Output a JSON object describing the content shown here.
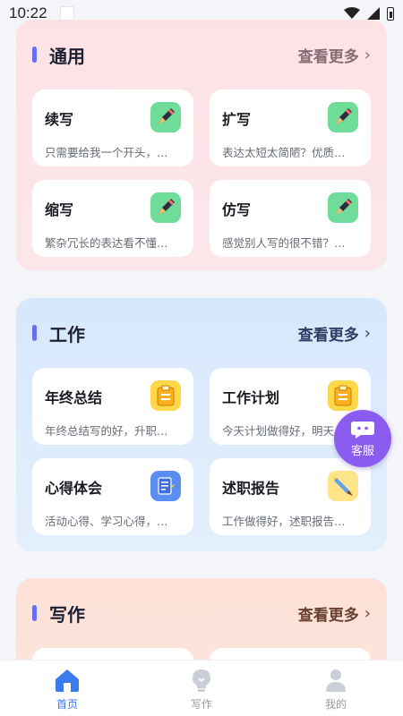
{
  "status_bar": {
    "time": "10:22"
  },
  "sections": [
    {
      "title": "通用",
      "more_label": "查看更多",
      "cards": [
        {
          "title": "续写",
          "desc": "只需要给我一个开头，…",
          "icon": "pen-icon"
        },
        {
          "title": "扩写",
          "desc": "表达太短太简陋？优质…",
          "icon": "pen-icon"
        },
        {
          "title": "缩写",
          "desc": "繁杂冗长的表达看不懂…",
          "icon": "pen-icon"
        },
        {
          "title": "仿写",
          "desc": "感觉别人写的很不错？…",
          "icon": "pen-icon"
        }
      ]
    },
    {
      "title": "工作",
      "more_label": "查看更多",
      "cards": [
        {
          "title": "年终总结",
          "desc": "年终总结写的好，升职…",
          "icon": "clipboard-icon"
        },
        {
          "title": "工作计划",
          "desc": "今天计划做得好，明天…",
          "icon": "clipboard-icon"
        },
        {
          "title": "心得体会",
          "desc": "活动心得、学习心得，…",
          "icon": "notes-icon"
        },
        {
          "title": "述职报告",
          "desc": "工作做得好，述职报告…",
          "icon": "brush-icon"
        }
      ]
    },
    {
      "title": "写作",
      "more_label": "查看更多"
    }
  ],
  "service_button": {
    "label": "客服"
  },
  "bottom_nav": {
    "items": [
      {
        "label": "首页",
        "icon": "home-icon",
        "active": true
      },
      {
        "label": "写作",
        "icon": "lightbulb-icon",
        "active": false
      },
      {
        "label": "我的",
        "icon": "user-icon",
        "active": false
      }
    ]
  },
  "colors": {
    "accent": "#3a7bf0",
    "section_bar": "#6470f0",
    "service_button": "#8a5cf0"
  }
}
